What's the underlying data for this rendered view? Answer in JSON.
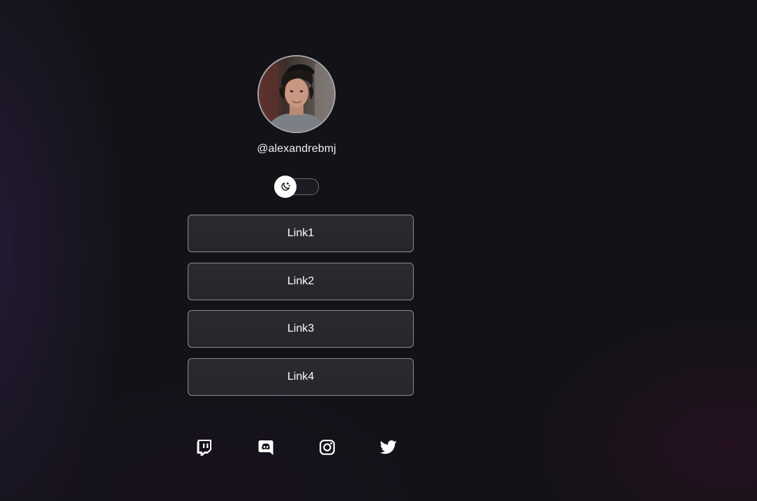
{
  "profile": {
    "username": "@alexandrebmj",
    "avatar_icon": "profile-photo"
  },
  "theme_toggle": {
    "icon": "moon-stars-icon",
    "state": "dark"
  },
  "links": [
    {
      "label": "Link1"
    },
    {
      "label": "Link2"
    },
    {
      "label": "Link3"
    },
    {
      "label": "Link4"
    }
  ],
  "socials": [
    {
      "icon": "twitch-icon"
    },
    {
      "icon": "discord-icon"
    },
    {
      "icon": "instagram-icon"
    },
    {
      "icon": "twitter-icon"
    }
  ],
  "colors": {
    "background": "#131217",
    "button_background": "#29282e",
    "button_border": "#8e8b93",
    "text": "#ffffff"
  }
}
